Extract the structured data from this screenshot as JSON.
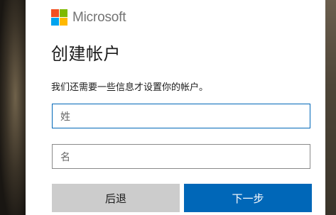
{
  "brand": {
    "name": "Microsoft",
    "logo_colors": [
      "#f25022",
      "#7fba00",
      "#00a4ef",
      "#ffb900"
    ]
  },
  "page": {
    "title": "创建帐户",
    "description": "我们还需要一些信息才设置你的帐户。"
  },
  "form": {
    "last_name": {
      "placeholder": "姓",
      "value": ""
    },
    "first_name": {
      "placeholder": "名",
      "value": ""
    }
  },
  "buttons": {
    "back": "后退",
    "next": "下一步"
  },
  "colors": {
    "accent": "#0067b8",
    "secondary_button": "#cccccc"
  }
}
